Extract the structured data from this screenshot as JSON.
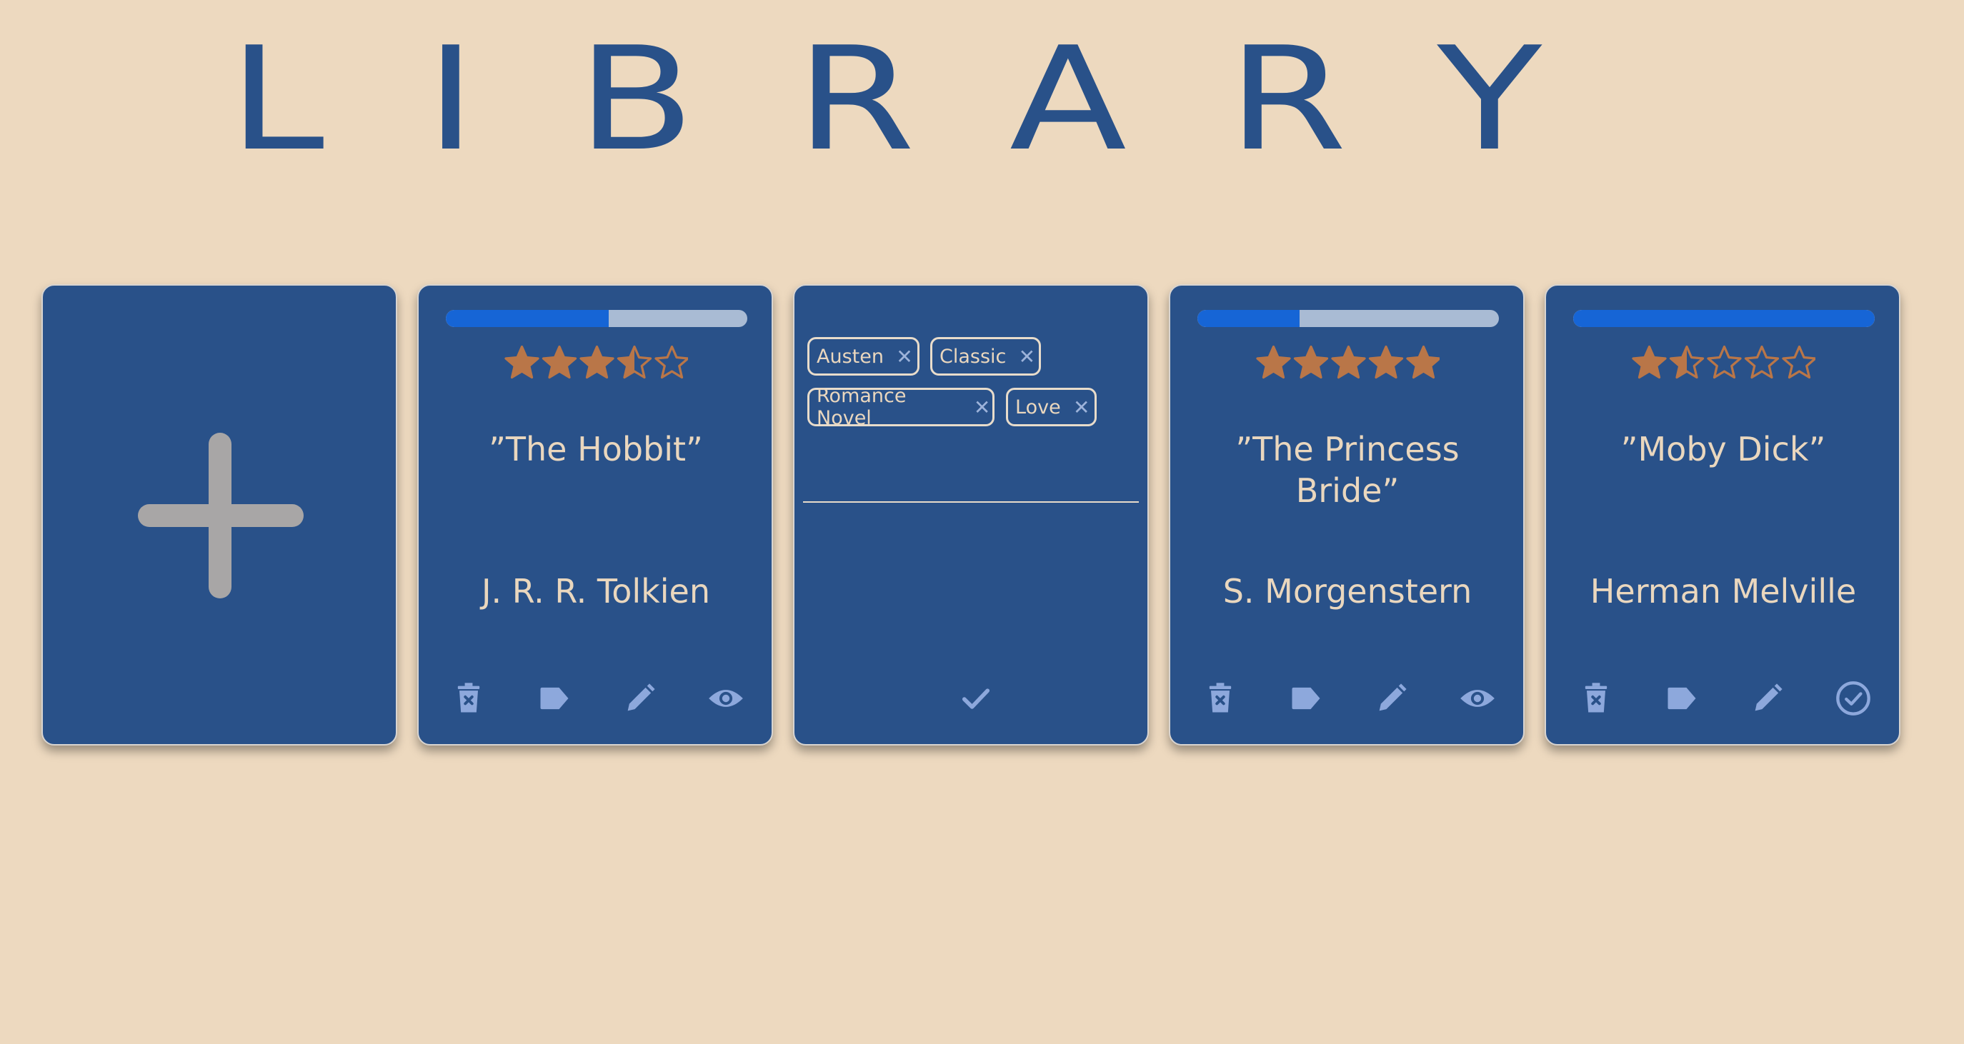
{
  "header": {
    "title": "LIBRARY"
  },
  "add_card": {
    "icon": "plus-icon"
  },
  "colors": {
    "background": "#EDD9BF",
    "card": "#295189",
    "accent": "#1665D6",
    "star": "#B97648",
    "icon": "#8DA8DC",
    "text": "#EAD7BE"
  },
  "books": [
    {
      "title": "”The Hobbit”",
      "author": "J. R. R. Tolkien",
      "progress": 0.54,
      "rating": 3.5,
      "read": false
    },
    {
      "title": "”The Princess Bride”",
      "author": "S. Morgenstern",
      "progress": 0.34,
      "rating": 5,
      "read": false
    },
    {
      "title": "”Moby Dick”",
      "author": "Herman Melville",
      "progress": 1.0,
      "rating": 1.5,
      "read": true
    }
  ],
  "tag_editor": {
    "tags": [
      "Austen",
      "Classic",
      "Romance Novel",
      "Love"
    ],
    "remove_glyph": "✕",
    "input_value": ""
  },
  "actions": {
    "delete": "trash-icon",
    "tag": "tag-icon",
    "edit": "pencil-icon",
    "view": "eye-icon",
    "read": "check-circle-icon",
    "confirm": "check-icon"
  }
}
